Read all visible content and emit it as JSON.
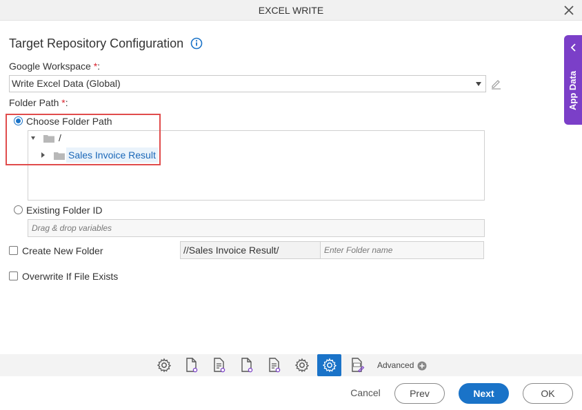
{
  "dialog": {
    "title": "EXCEL WRITE"
  },
  "page": {
    "title": "Target Repository Configuration"
  },
  "google_workspace": {
    "label": "Google Workspace",
    "required_mark": "*",
    "colon": ":",
    "selected": "Write Excel Data (Global)"
  },
  "folder_path": {
    "label": "Folder Path",
    "required_mark": "*",
    "colon": ":",
    "choose_label": "Choose Folder Path",
    "choose_checked": true,
    "tree": {
      "root": "/",
      "child": "Sales Invoice Result"
    },
    "existing_label": "Existing Folder ID",
    "existing_placeholder": "Drag & drop variables"
  },
  "create_new_folder": {
    "label": "Create New Folder",
    "prefix": "//Sales Invoice Result/",
    "placeholder": "Enter Folder name"
  },
  "overwrite": {
    "label": "Overwrite If File Exists"
  },
  "toolbar": {
    "advanced_label": "Advanced"
  },
  "footer": {
    "cancel": "Cancel",
    "prev": "Prev",
    "next": "Next",
    "ok": "OK"
  },
  "side_panel": {
    "label": "App Data"
  },
  "colors": {
    "primary": "#1a73c8",
    "side_panel": "#7b3fc8",
    "highlight": "#e04b4b"
  }
}
